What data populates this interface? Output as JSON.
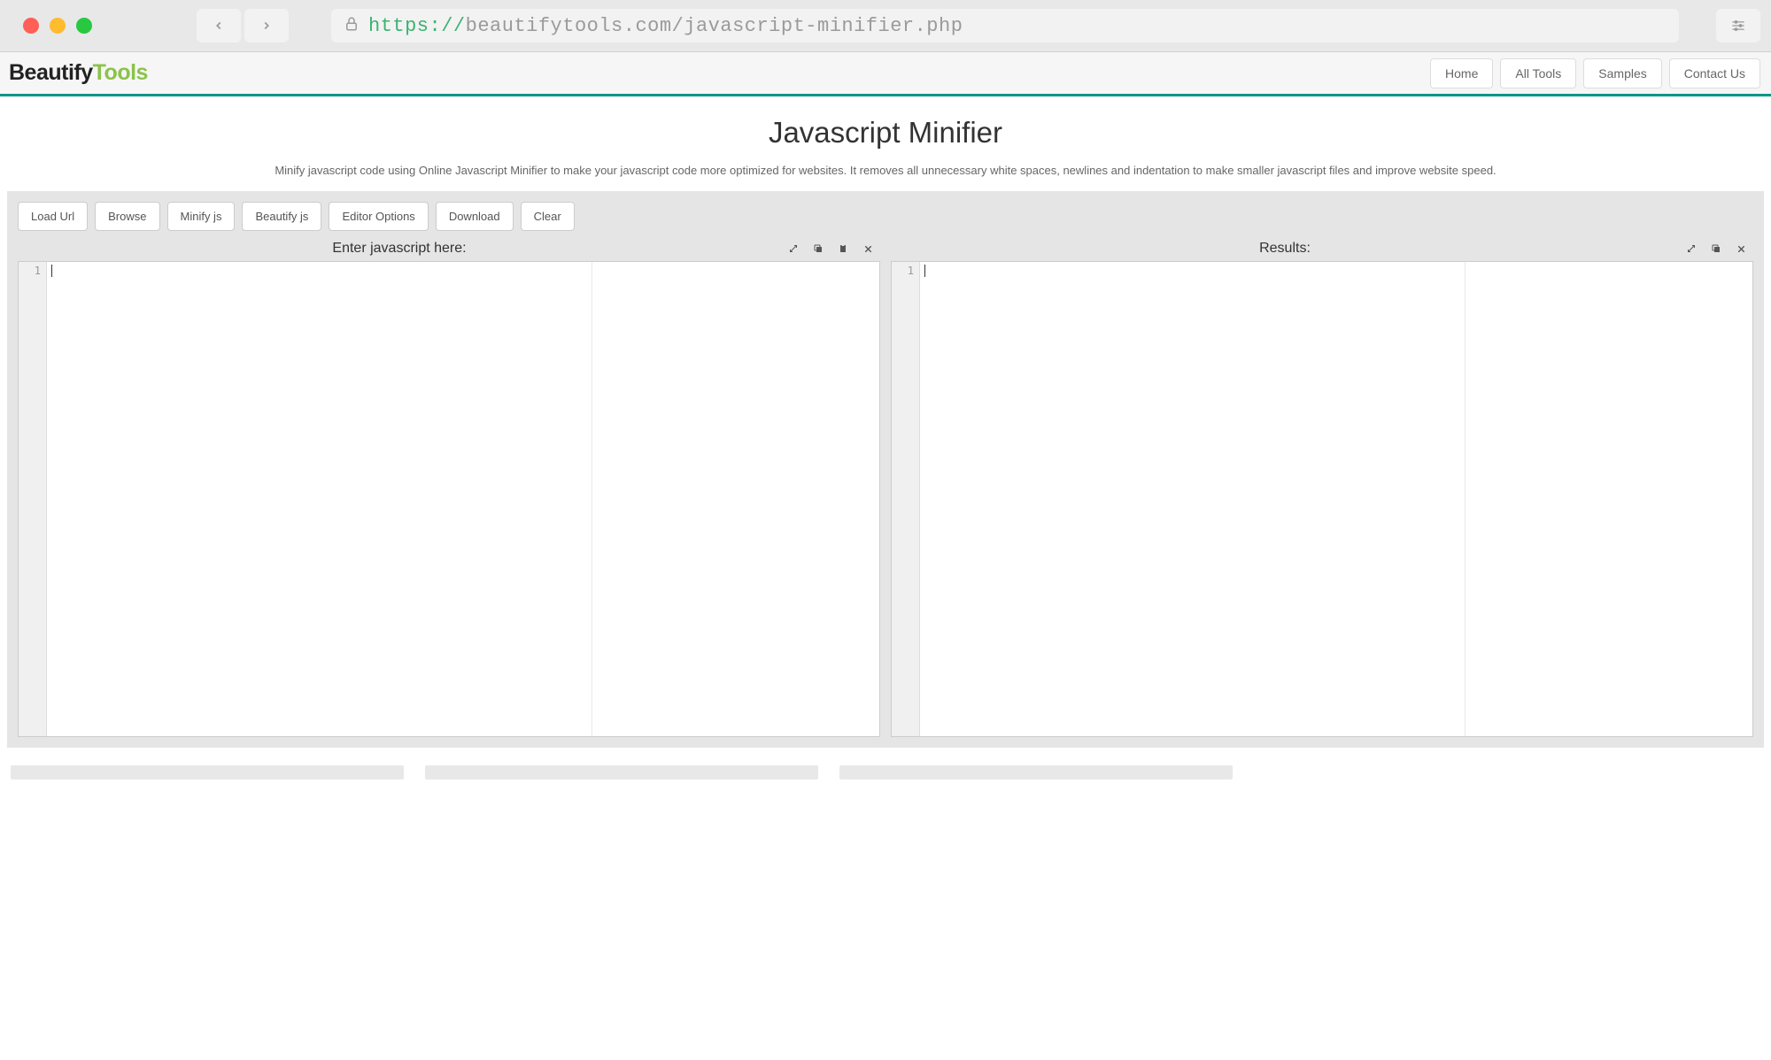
{
  "browser": {
    "url_protocol": "https://",
    "url_host": "beautifytools.com",
    "url_path": "/javascript-minifier.php"
  },
  "header": {
    "logo_part1": "Beautify",
    "logo_part2": "Tools",
    "nav": [
      "Home",
      "All Tools",
      "Samples",
      "Contact Us"
    ]
  },
  "page": {
    "title": "Javascript Minifier",
    "description": "Minify javascript code using Online Javascript Minifier to make your javascript code more optimized for websites. It removes all unnecessary white spaces, newlines and indentation to make smaller javascript files and improve website speed."
  },
  "toolbar": {
    "buttons": [
      "Load Url",
      "Browse",
      "Minify js",
      "Beautify js",
      "Editor Options",
      "Download",
      "Clear"
    ]
  },
  "editors": {
    "input_title": "Enter javascript here:",
    "input_line_number": "1",
    "output_title": "Results:",
    "output_line_number": "1"
  }
}
